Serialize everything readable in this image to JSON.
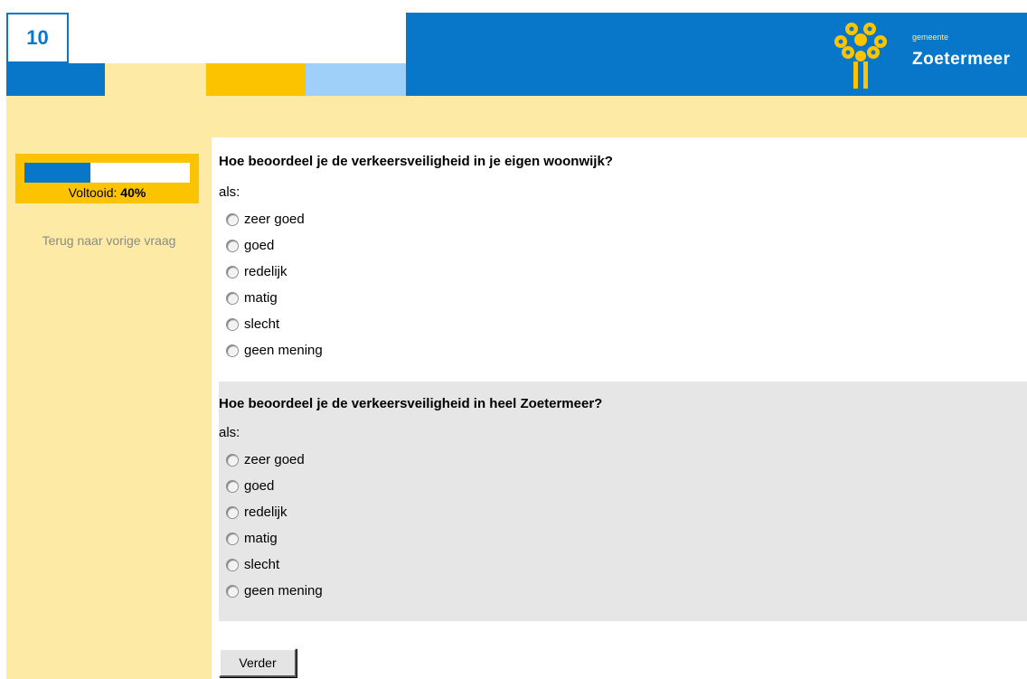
{
  "page_number": "10",
  "brand": {
    "small": "gemeente",
    "name": "Zoetermeer"
  },
  "progress": {
    "label": "Voltooid:",
    "value_text": "40%",
    "fraction": 0.4
  },
  "back_link": "Terug naar vorige vraag",
  "colors": {
    "blue": "#0877c9",
    "yellow": "#fdeba5",
    "orange": "#fcc400",
    "light_blue": "#9fd0fa",
    "grey": "#e6e6e6"
  },
  "questions": [
    {
      "title": "Hoe beoordeel je de verkeersveiligheid in je eigen woonwijk?",
      "prefix": "als:",
      "options": [
        "zeer goed",
        "goed",
        "redelijk",
        "matig",
        "slecht",
        "geen mening"
      ]
    },
    {
      "title": "Hoe beoordeel je de verkeersveiligheid in heel Zoetermeer?",
      "prefix": "als:",
      "options": [
        "zeer goed",
        "goed",
        "redelijk",
        "matig",
        "slecht",
        "geen mening"
      ]
    }
  ],
  "next_button": "Verder"
}
